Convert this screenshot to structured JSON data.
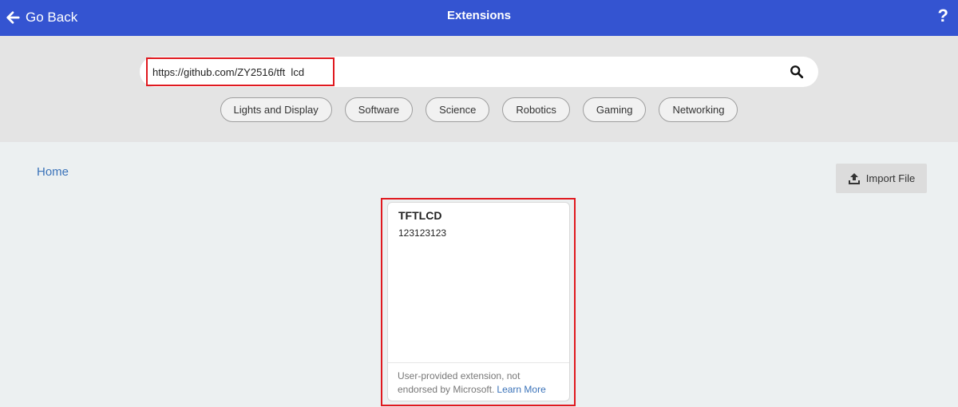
{
  "header": {
    "back_label": "Go Back",
    "title": "Extensions",
    "help_label": "?"
  },
  "search": {
    "value": "https://github.com/ZY2516/tft  lcd"
  },
  "categories": [
    "Lights and Display",
    "Software",
    "Science",
    "Robotics",
    "Gaming",
    "Networking"
  ],
  "breadcrumb": {
    "home_label": "Home"
  },
  "toolbar": {
    "import_label": "Import File"
  },
  "results": [
    {
      "title": "TFTLCD",
      "description": "123123123",
      "footer_text": "User-provided extension, not endorsed by Microsoft.",
      "learn_more": "Learn More"
    }
  ],
  "colors": {
    "header_bg": "#3454d1",
    "highlight": "#e0191f",
    "link": "#3b73b9"
  }
}
